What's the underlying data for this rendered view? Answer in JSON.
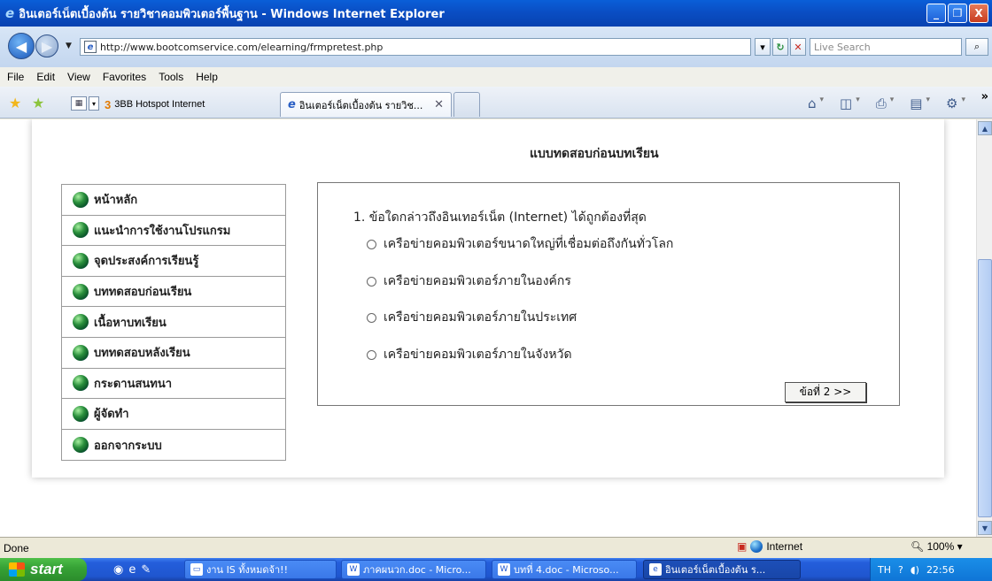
{
  "window": {
    "title": "อินเตอร์เน็ตเบื้องต้น รายวิชาคอมพิวเตอร์พื้นฐาน - Windows Internet Explorer",
    "minimize_label": "_",
    "maximize_label": "❐",
    "close_label": "X"
  },
  "address": {
    "url": "http://www.bootcomservice.com/elearning/frmpretest.php",
    "search_placeholder": "Live Search"
  },
  "menu": {
    "items": [
      "File",
      "Edit",
      "View",
      "Favorites",
      "Tools",
      "Help"
    ]
  },
  "tabs": {
    "link_tab": "3BB Hotspot Internet",
    "active_tab": "อินเตอร์เน็ตเบื้องต้น รายวิช..."
  },
  "page": {
    "heading": "แบบทดสอบก่อนบทเรียน",
    "sidebar": [
      "หน้าหลัก",
      "แนะนำการใช้งานโปรแกรม",
      "จุดประสงค์การเรียนรู้",
      "บททดสอบก่อนเรียน",
      "เนื้อหาบทเรียน",
      "บททดสอบหลังเรียน",
      "กระดานสนทนา",
      "ผู้จัดทำ",
      "ออกจากระบบ"
    ],
    "question": "1. ข้อใดกล่าวถึงอินเทอร์เน็ต (Internet) ได้ถูกต้องที่สุด",
    "options": [
      "เครือข่ายคอมพิวเตอร์ขนาดใหญ่ที่เชื่อมต่อถึงกันทั่วโลก",
      "เครือข่ายคอมพิวเตอร์ภายในองค์กร",
      "เครือข่ายคอมพิวเตอร์ภายในประเทศ",
      "เครือข่ายคอมพิวเตอร์ภายในจังหวัด"
    ],
    "next_button": "ข้อที่ 2 >>"
  },
  "status": {
    "text": "Done",
    "zone": "Internet",
    "zoom": "100%"
  },
  "taskbar": {
    "start": "start",
    "tasks": [
      "งาน IS ทั้งหมดจ้า!!",
      "ภาคผนวก.doc - Micro...",
      "บทที่ 4.doc - Microso...",
      "อินเตอร์เน็ตเบื้องต้น ร..."
    ],
    "lang": "TH",
    "clock": "22:56"
  },
  "colors": {
    "titlebar": "#0a4ec4",
    "taskbar": "#245edb",
    "start": "#37a336"
  }
}
